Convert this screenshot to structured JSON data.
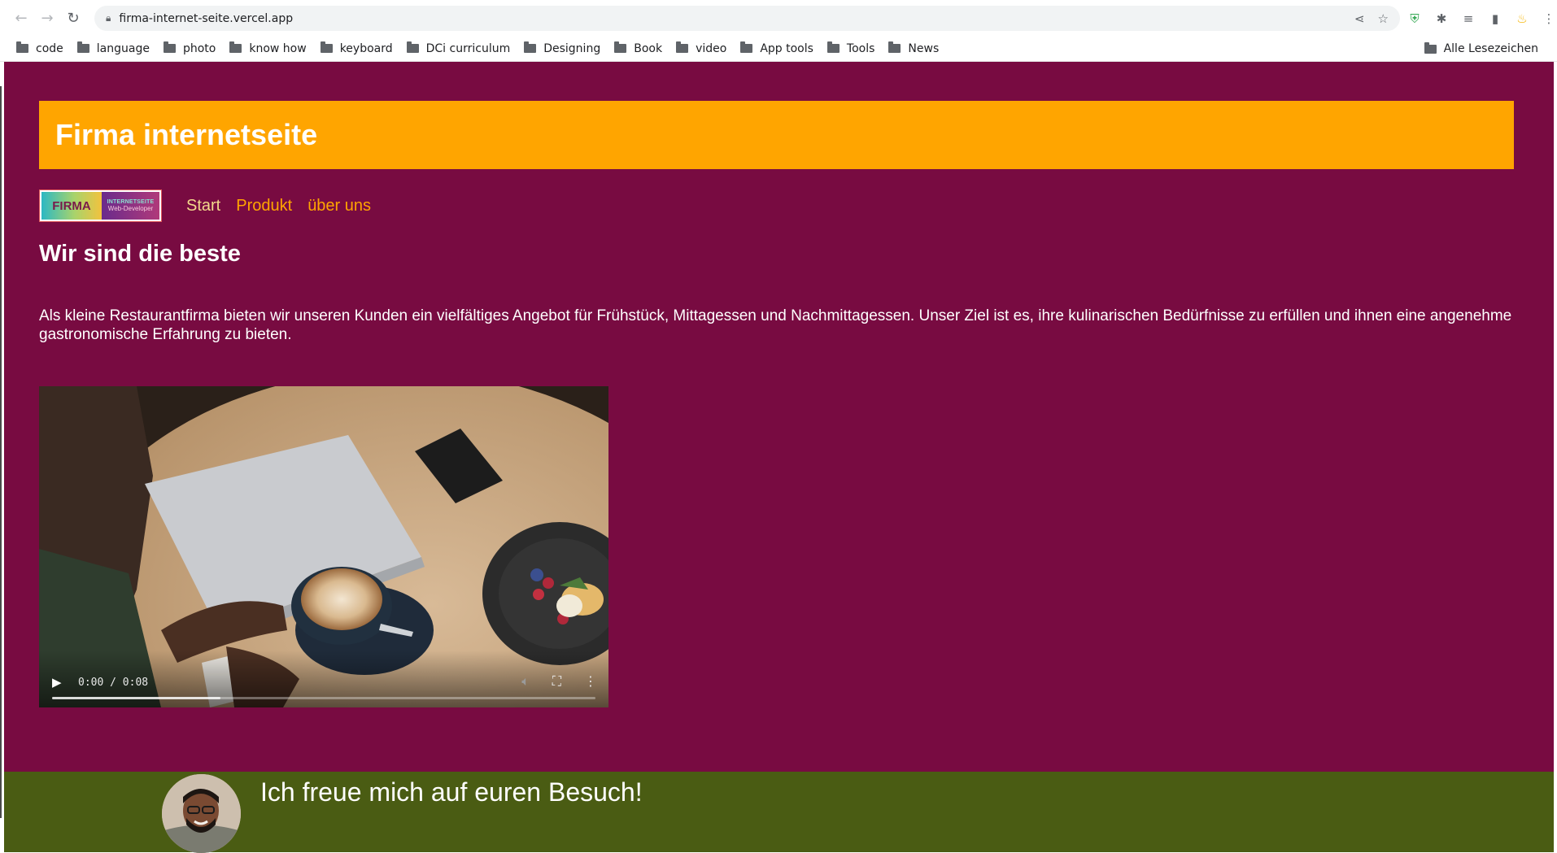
{
  "browser": {
    "url": "firma-internet-seite.vercel.app",
    "bookmarks": [
      "code",
      "language",
      "photo",
      "know how",
      "keyboard",
      "DCi curriculum",
      "Designing",
      "Book",
      "video",
      "App tools",
      "Tools",
      "News"
    ],
    "all_bookmarks_label": "Alle Lesezeichen",
    "icons": {
      "back": "back-arrow-icon",
      "forward": "forward-arrow-icon",
      "reload": "reload-icon",
      "lock": "lock-icon",
      "share": "share-icon",
      "star": "bookmark-star-icon",
      "extensions": [
        "shield-extension-icon",
        "puzzle-extensions-icon",
        "reading-list-icon",
        "side-panel-icon",
        "profile-extension-icon",
        "menu-dots-icon"
      ]
    }
  },
  "page": {
    "header_title": "Firma internetseite",
    "logo": {
      "main": "FIRMA",
      "line1": "INTERNETSEITE",
      "line2": "Web-Developer"
    },
    "nav": {
      "start": "Start",
      "produkt": "Produkt",
      "about": "über uns"
    },
    "tagline": "Wir sind die beste",
    "intro": "Als kleine Restaurantfirma bieten wir unseren Kunden ein vielfältiges Angebot für Frühstück, Mittagessen und Nachmittagessen. Unser Ziel ist es, ihre kulinarischen Bedürfnisse zu erfüllen und ihnen eine angenehme gastronomische Erfahrung zu bieten.",
    "video": {
      "time": "0:00 / 0:08",
      "buffered_fraction": 0.31
    },
    "footer_text": "Ich freue mich auf euren Besuch!"
  },
  "colors": {
    "page_bg": "#780b41",
    "header_bg": "#ffa500",
    "nav_start": "#f3d98b",
    "nav_link": "#ffa500",
    "footer_bg": "#4a5c13"
  }
}
